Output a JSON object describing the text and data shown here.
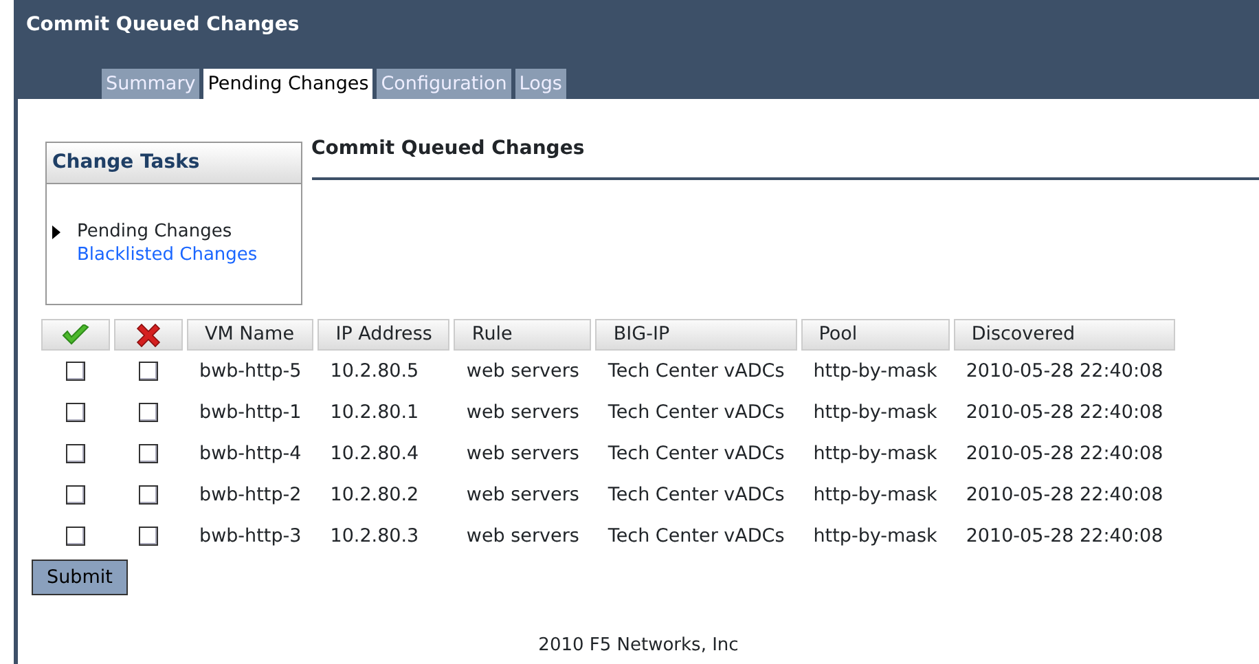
{
  "window": {
    "title": "Commit Queued Changes"
  },
  "tabs": [
    {
      "label": "Summary",
      "selected": false
    },
    {
      "label": "Pending Changes",
      "selected": true
    },
    {
      "label": "Configuration",
      "selected": false
    },
    {
      "label": "Logs",
      "selected": false
    }
  ],
  "sidebar": {
    "title": "Change Tasks",
    "items": [
      {
        "label": "Pending Changes",
        "selected": true
      },
      {
        "label": "Blacklisted Changes",
        "selected": false
      }
    ]
  },
  "heading": "Commit Queued Changes",
  "table": {
    "columns": [
      {
        "kind": "accept"
      },
      {
        "kind": "reject"
      },
      {
        "kind": "text",
        "label": "VM Name"
      },
      {
        "kind": "text",
        "label": "IP Address"
      },
      {
        "kind": "text",
        "label": "Rule"
      },
      {
        "kind": "text",
        "label": "BIG-IP"
      },
      {
        "kind": "text",
        "label": "Pool"
      },
      {
        "kind": "text",
        "label": "Discovered"
      }
    ],
    "rows": [
      {
        "cells": [
          {
            "kind": "checkbox",
            "checked": false
          },
          {
            "kind": "checkbox",
            "checked": false
          },
          "bwb-http-5",
          "10.2.80.5",
          "web servers",
          "Tech Center vADCs",
          "http-by-mask",
          "2010-05-28 22:40:08"
        ]
      },
      {
        "cells": [
          {
            "kind": "checkbox",
            "checked": false
          },
          {
            "kind": "checkbox",
            "checked": false
          },
          "bwb-http-1",
          "10.2.80.1",
          "web servers",
          "Tech Center vADCs",
          "http-by-mask",
          "2010-05-28 22:40:08"
        ]
      },
      {
        "cells": [
          {
            "kind": "checkbox",
            "checked": false
          },
          {
            "kind": "checkbox",
            "checked": false
          },
          "bwb-http-4",
          "10.2.80.4",
          "web servers",
          "Tech Center vADCs",
          "http-by-mask",
          "2010-05-28 22:40:08"
        ]
      },
      {
        "cells": [
          {
            "kind": "checkbox",
            "checked": false
          },
          {
            "kind": "checkbox",
            "checked": false
          },
          "bwb-http-2",
          "10.2.80.2",
          "web servers",
          "Tech Center vADCs",
          "http-by-mask",
          "2010-05-28 22:40:08"
        ]
      },
      {
        "cells": [
          {
            "kind": "checkbox",
            "checked": false
          },
          {
            "kind": "checkbox",
            "checked": false
          },
          "bwb-http-3",
          "10.2.80.3",
          "web servers",
          "Tech Center vADCs",
          "http-by-mask",
          "2010-05-28 22:40:08"
        ]
      }
    ]
  },
  "submit_button": "Submit",
  "footer": "2010 F5 Networks, Inc"
}
